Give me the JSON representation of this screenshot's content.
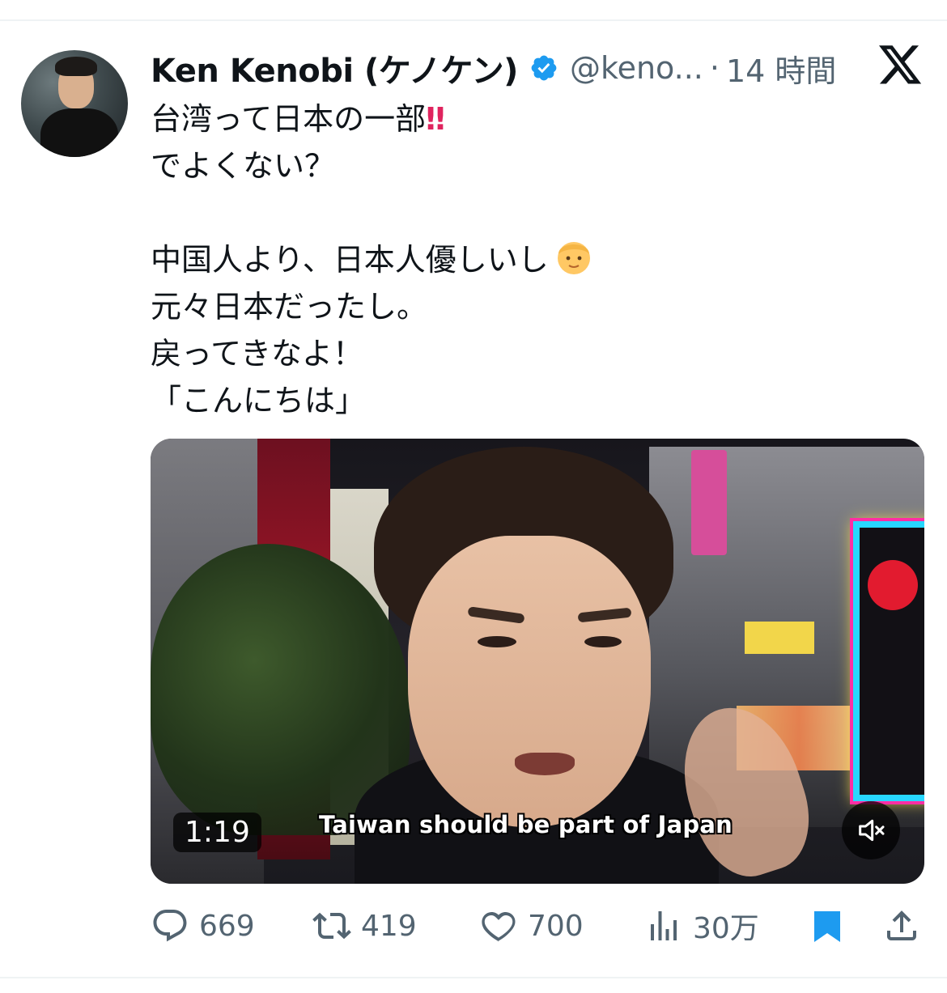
{
  "author": {
    "display_name": "Ken Kenobi (ケノケン)",
    "handle": "@keno...",
    "separator": "·",
    "timestamp": "14 時間",
    "verified": true
  },
  "tweet": {
    "lines": [
      "台湾って日本の一部",
      "でよくない？",
      "",
      "中国人より、日本人優しいし",
      "元々日本だったし。",
      "戻ってきなよ！",
      "「こんにちは」"
    ],
    "emoji_after_line_1": "‼",
    "emoji_after_line_4": "boy-face-emoji"
  },
  "media": {
    "duration": "1:19",
    "caption": "Taiwan should be part of Japan",
    "muted": true
  },
  "actions": {
    "replies": "669",
    "retweets": "419",
    "likes": "700",
    "views": "30万",
    "bookmarked": true
  },
  "colors": {
    "accent": "#1d9bf0",
    "muted_text": "#536471",
    "text": "#0f1419",
    "bangbang": "#e0245e"
  }
}
